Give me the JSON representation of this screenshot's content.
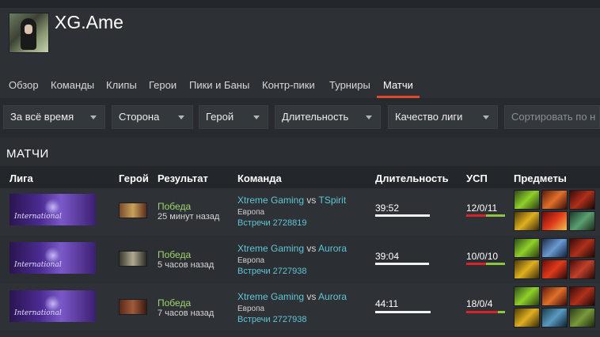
{
  "profile": {
    "name": "XG.Ame"
  },
  "nav": {
    "items": [
      "Обзор",
      "Команды",
      "Клипы",
      "Герои",
      "Пики и Баны",
      "Контр-пики",
      "Турниры",
      "Матчи"
    ],
    "active": "Матчи"
  },
  "filters": {
    "time": "За всё время",
    "side": "Сторона",
    "hero": "Герой",
    "duration": "Длительность",
    "league_quality": "Качество лиги",
    "sort_placeholder": "Сортировать по н"
  },
  "section_title": "МАТЧИ",
  "table": {
    "headers": [
      "Лига",
      "Герой",
      "Результат",
      "Команда",
      "Длительность",
      "УСП",
      "Предметы"
    ],
    "league_text": "International",
    "rows": [
      {
        "result": "Победа",
        "time_ago": "25 минут назад",
        "team": "Xtreme Gaming",
        "vs": "vs",
        "opponent": "TSpirit",
        "region": "Европа",
        "series": "Встречи 2728819",
        "duration": "39:52",
        "duration_fraction": 0.99,
        "kda": "12/0/11",
        "kda_red_fraction": 0.52
      },
      {
        "result": "Победа",
        "time_ago": "5 часов назад",
        "team": "Xtreme Gaming",
        "vs": "vs",
        "opponent": "Aurora",
        "region": "Европа",
        "series": "Встречи 2727938",
        "duration": "39:04",
        "duration_fraction": 0.97,
        "kda": "10/0/10",
        "kda_red_fraction": 0.5
      },
      {
        "result": "Победа",
        "time_ago": "7 часов назад",
        "team": "Xtreme Gaming",
        "vs": "vs",
        "opponent": "Aurora",
        "region": "Европа",
        "series": "Встречи 2727938",
        "duration": "44:11",
        "duration_fraction": 1.0,
        "kda": "18/0/4",
        "kda_red_fraction": 0.82
      }
    ]
  },
  "colors": {
    "accent": "#e04a2a",
    "win": "#9fd56c",
    "link": "#5fc6d6",
    "kda_red": "#d9232a",
    "kda_green": "#8cc63e"
  }
}
